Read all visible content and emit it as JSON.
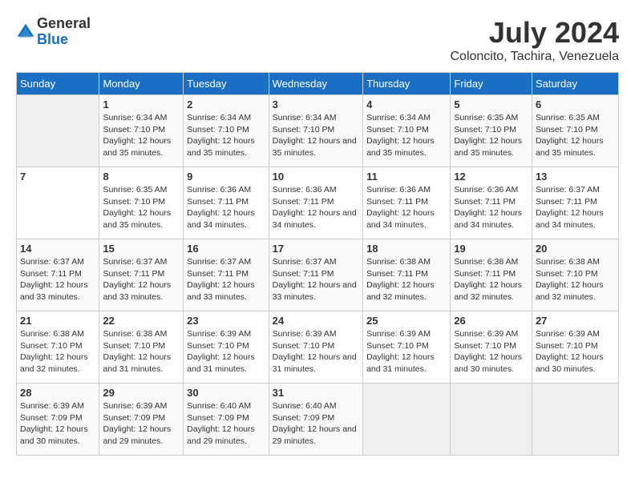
{
  "logo": {
    "general": "General",
    "blue": "Blue"
  },
  "title": {
    "month_year": "July 2024",
    "location": "Coloncito, Tachira, Venezuela"
  },
  "days_of_week": [
    "Sunday",
    "Monday",
    "Tuesday",
    "Wednesday",
    "Thursday",
    "Friday",
    "Saturday"
  ],
  "weeks": [
    [
      {
        "day": "",
        "sunrise": "",
        "sunset": "",
        "daylight": ""
      },
      {
        "day": "1",
        "sunrise": "Sunrise: 6:34 AM",
        "sunset": "Sunset: 7:10 PM",
        "daylight": "Daylight: 12 hours and 35 minutes."
      },
      {
        "day": "2",
        "sunrise": "Sunrise: 6:34 AM",
        "sunset": "Sunset: 7:10 PM",
        "daylight": "Daylight: 12 hours and 35 minutes."
      },
      {
        "day": "3",
        "sunrise": "Sunrise: 6:34 AM",
        "sunset": "Sunset: 7:10 PM",
        "daylight": "Daylight: 12 hours and 35 minutes."
      },
      {
        "day": "4",
        "sunrise": "Sunrise: 6:34 AM",
        "sunset": "Sunset: 7:10 PM",
        "daylight": "Daylight: 12 hours and 35 minutes."
      },
      {
        "day": "5",
        "sunrise": "Sunrise: 6:35 AM",
        "sunset": "Sunset: 7:10 PM",
        "daylight": "Daylight: 12 hours and 35 minutes."
      },
      {
        "day": "6",
        "sunrise": "Sunrise: 6:35 AM",
        "sunset": "Sunset: 7:10 PM",
        "daylight": "Daylight: 12 hours and 35 minutes."
      }
    ],
    [
      {
        "day": "7",
        "sunrise": "",
        "sunset": "",
        "daylight": ""
      },
      {
        "day": "8",
        "sunrise": "Sunrise: 6:35 AM",
        "sunset": "Sunset: 7:10 PM",
        "daylight": "Daylight: 12 hours and 35 minutes."
      },
      {
        "day": "9",
        "sunrise": "Sunrise: 6:36 AM",
        "sunset": "Sunset: 7:11 PM",
        "daylight": "Daylight: 12 hours and 34 minutes."
      },
      {
        "day": "10",
        "sunrise": "Sunrise: 6:36 AM",
        "sunset": "Sunset: 7:11 PM",
        "daylight": "Daylight: 12 hours and 34 minutes."
      },
      {
        "day": "11",
        "sunrise": "Sunrise: 6:36 AM",
        "sunset": "Sunset: 7:11 PM",
        "daylight": "Daylight: 12 hours and 34 minutes."
      },
      {
        "day": "12",
        "sunrise": "Sunrise: 6:36 AM",
        "sunset": "Sunset: 7:11 PM",
        "daylight": "Daylight: 12 hours and 34 minutes."
      },
      {
        "day": "13",
        "sunrise": "Sunrise: 6:37 AM",
        "sunset": "Sunset: 7:11 PM",
        "daylight": "Daylight: 12 hours and 34 minutes."
      }
    ],
    [
      {
        "day": "14",
        "sunrise": "Sunrise: 6:37 AM",
        "sunset": "Sunset: 7:11 PM",
        "daylight": "Daylight: 12 hours and 33 minutes."
      },
      {
        "day": "15",
        "sunrise": "Sunrise: 6:37 AM",
        "sunset": "Sunset: 7:11 PM",
        "daylight": "Daylight: 12 hours and 33 minutes."
      },
      {
        "day": "16",
        "sunrise": "Sunrise: 6:37 AM",
        "sunset": "Sunset: 7:11 PM",
        "daylight": "Daylight: 12 hours and 33 minutes."
      },
      {
        "day": "17",
        "sunrise": "Sunrise: 6:37 AM",
        "sunset": "Sunset: 7:11 PM",
        "daylight": "Daylight: 12 hours and 33 minutes."
      },
      {
        "day": "18",
        "sunrise": "Sunrise: 6:38 AM",
        "sunset": "Sunset: 7:11 PM",
        "daylight": "Daylight: 12 hours and 32 minutes."
      },
      {
        "day": "19",
        "sunrise": "Sunrise: 6:38 AM",
        "sunset": "Sunset: 7:11 PM",
        "daylight": "Daylight: 12 hours and 32 minutes."
      },
      {
        "day": "20",
        "sunrise": "Sunrise: 6:38 AM",
        "sunset": "Sunset: 7:10 PM",
        "daylight": "Daylight: 12 hours and 32 minutes."
      }
    ],
    [
      {
        "day": "21",
        "sunrise": "Sunrise: 6:38 AM",
        "sunset": "Sunset: 7:10 PM",
        "daylight": "Daylight: 12 hours and 32 minutes."
      },
      {
        "day": "22",
        "sunrise": "Sunrise: 6:38 AM",
        "sunset": "Sunset: 7:10 PM",
        "daylight": "Daylight: 12 hours and 31 minutes."
      },
      {
        "day": "23",
        "sunrise": "Sunrise: 6:39 AM",
        "sunset": "Sunset: 7:10 PM",
        "daylight": "Daylight: 12 hours and 31 minutes."
      },
      {
        "day": "24",
        "sunrise": "Sunrise: 6:39 AM",
        "sunset": "Sunset: 7:10 PM",
        "daylight": "Daylight: 12 hours and 31 minutes."
      },
      {
        "day": "25",
        "sunrise": "Sunrise: 6:39 AM",
        "sunset": "Sunset: 7:10 PM",
        "daylight": "Daylight: 12 hours and 31 minutes."
      },
      {
        "day": "26",
        "sunrise": "Sunrise: 6:39 AM",
        "sunset": "Sunset: 7:10 PM",
        "daylight": "Daylight: 12 hours and 30 minutes."
      },
      {
        "day": "27",
        "sunrise": "Sunrise: 6:39 AM",
        "sunset": "Sunset: 7:10 PM",
        "daylight": "Daylight: 12 hours and 30 minutes."
      }
    ],
    [
      {
        "day": "28",
        "sunrise": "Sunrise: 6:39 AM",
        "sunset": "Sunset: 7:09 PM",
        "daylight": "Daylight: 12 hours and 30 minutes."
      },
      {
        "day": "29",
        "sunrise": "Sunrise: 6:39 AM",
        "sunset": "Sunset: 7:09 PM",
        "daylight": "Daylight: 12 hours and 29 minutes."
      },
      {
        "day": "30",
        "sunrise": "Sunrise: 6:40 AM",
        "sunset": "Sunset: 7:09 PM",
        "daylight": "Daylight: 12 hours and 29 minutes."
      },
      {
        "day": "31",
        "sunrise": "Sunrise: 6:40 AM",
        "sunset": "Sunset: 7:09 PM",
        "daylight": "Daylight: 12 hours and 29 minutes."
      },
      {
        "day": "",
        "sunrise": "",
        "sunset": "",
        "daylight": ""
      },
      {
        "day": "",
        "sunrise": "",
        "sunset": "",
        "daylight": ""
      },
      {
        "day": "",
        "sunrise": "",
        "sunset": "",
        "daylight": ""
      }
    ]
  ]
}
